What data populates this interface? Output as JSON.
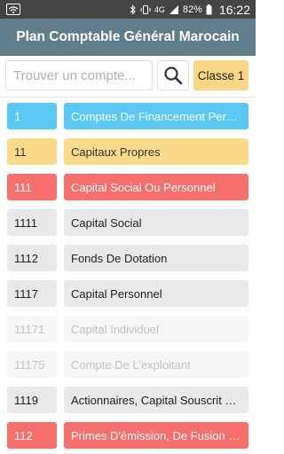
{
  "status": {
    "network": "4G",
    "battery": "82%",
    "time": "16:22"
  },
  "app": {
    "title": "Plan Comptable Général Marocain"
  },
  "search": {
    "placeholder": "Trouver un compte...",
    "value": ""
  },
  "classe_button": "Classe 1",
  "colors": {
    "appbar": "#607D8B",
    "blue": "#5BC8F5",
    "yellow": "#F9DB8A",
    "red": "#F76F6C",
    "gray": "#E8E8E8"
  },
  "accounts": [
    {
      "code": "1",
      "label": "Comptes De Financement Permanent",
      "style": "blue"
    },
    {
      "code": "11",
      "label": "Capitaux Propres",
      "style": "yellow"
    },
    {
      "code": "111",
      "label": "Capital Social Ou Personnel",
      "style": "red"
    },
    {
      "code": "1111",
      "label": "Capital Social",
      "style": "gray"
    },
    {
      "code": "1112",
      "label": "Fonds De Dotation",
      "style": "gray"
    },
    {
      "code": "1117",
      "label": "Capital Personnel",
      "style": "gray"
    },
    {
      "code": "11171",
      "label": "Capital Individuel",
      "style": "light"
    },
    {
      "code": "11175",
      "label": "Compte De L'exploitant",
      "style": "light"
    },
    {
      "code": "1119",
      "label": "Actionnaires, Capital Souscrit Non Appelé",
      "style": "gray"
    },
    {
      "code": "112",
      "label": "Primes D'émission, De Fusion Et D'apport",
      "style": "red"
    }
  ]
}
